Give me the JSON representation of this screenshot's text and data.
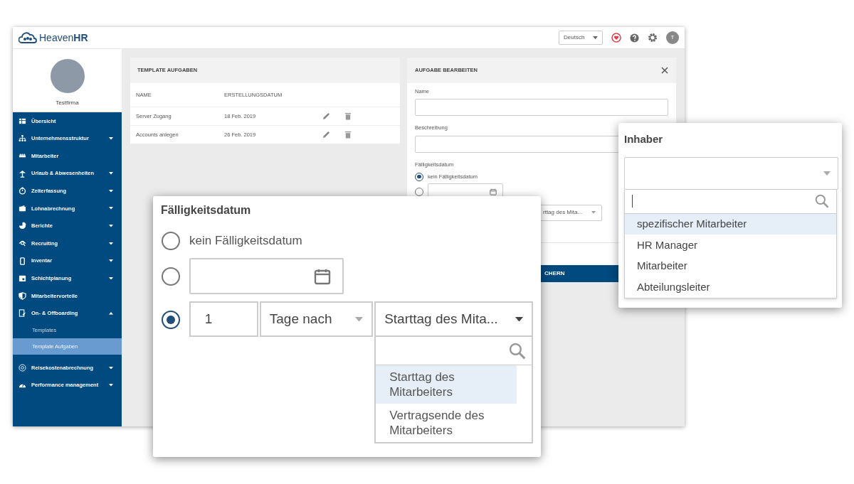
{
  "app": {
    "logo": "Heaven**HR**",
    "language": "Deutsch",
    "avatar_initial": "T",
    "company": "Testfirma"
  },
  "sidebar": {
    "items": [
      {
        "label": "Übersicht",
        "expandable": false
      },
      {
        "label": "Unternehmensstruktur",
        "expandable": true,
        "expanded": false
      },
      {
        "label": "Mitarbeiter",
        "expandable": false
      },
      {
        "label": "Urlaub & Abwesenheiten",
        "expandable": true,
        "expanded": false
      },
      {
        "label": "Zeiterfassung",
        "expandable": true,
        "expanded": false
      },
      {
        "label": "Lohnabrechnung",
        "expandable": true,
        "expanded": false
      },
      {
        "label": "Berichte",
        "expandable": true,
        "expanded": false
      },
      {
        "label": "Recruiting",
        "expandable": true,
        "expanded": false
      },
      {
        "label": "Inventar",
        "expandable": true,
        "expanded": false
      },
      {
        "label": "Schichtplanung",
        "expandable": true,
        "expanded": false
      },
      {
        "label": "Mitarbeitervorteile",
        "expandable": false
      },
      {
        "label": "On- & Offboarding",
        "expandable": true,
        "expanded": true,
        "children": [
          {
            "label": "Templates",
            "selected": false
          },
          {
            "label": "Template Aufgaben",
            "selected": true
          }
        ]
      },
      {
        "label": "Reisekostenabrechnung",
        "expandable": true,
        "expanded": false
      },
      {
        "label": "Performance management",
        "expandable": true,
        "expanded": false
      }
    ]
  },
  "template_card": {
    "title": "TEMPLATE AUFGABEN",
    "columns": [
      "NAME",
      "ERSTELLUNGSDATUM"
    ],
    "rows": [
      {
        "name": "Server Zugang",
        "date": "18 Feb. 2019"
      },
      {
        "name": "Accounts anlegen",
        "date": "26 Feb. 2019"
      }
    ]
  },
  "edit_panel": {
    "title": "AUFGABE BEARBEITEN",
    "fields": [
      {
        "label": "Name"
      },
      {
        "label": "Beschreibung"
      }
    ],
    "due_label": "Fälligkeitsdatum",
    "options": [
      {
        "kind": "none",
        "label": "kein Fälligkeitsdatum",
        "selected": true
      },
      {
        "kind": "date",
        "selected": false
      }
    ],
    "relative_select": "rttag des Mita...",
    "save_button": "CHERN"
  },
  "due_date_popup": {
    "title": "Fälligkeitsdatum",
    "options": [
      {
        "kind": "none",
        "label": "kein Fälligkeitsdatum",
        "selected": false
      },
      {
        "kind": "date",
        "selected": false
      },
      {
        "kind": "relative",
        "selected": true,
        "amount": "1",
        "unit": "Tage nach",
        "reference": "Starttag des Mita...",
        "dropdown": [
          {
            "label": "Starttag des Mitarbeiters",
            "selected": true
          },
          {
            "label": "Vertragsende des Mitarbeiters",
            "selected": false
          }
        ]
      }
    ]
  },
  "owner_popup": {
    "title": "Inhaber",
    "options": [
      {
        "label": "spezifischer Mitarbeiter",
        "selected": true
      },
      {
        "label": "HR Manager",
        "selected": false
      },
      {
        "label": "Mitarbeiter",
        "selected": false
      },
      {
        "label": "Abteilungsleiter",
        "selected": false
      }
    ]
  }
}
